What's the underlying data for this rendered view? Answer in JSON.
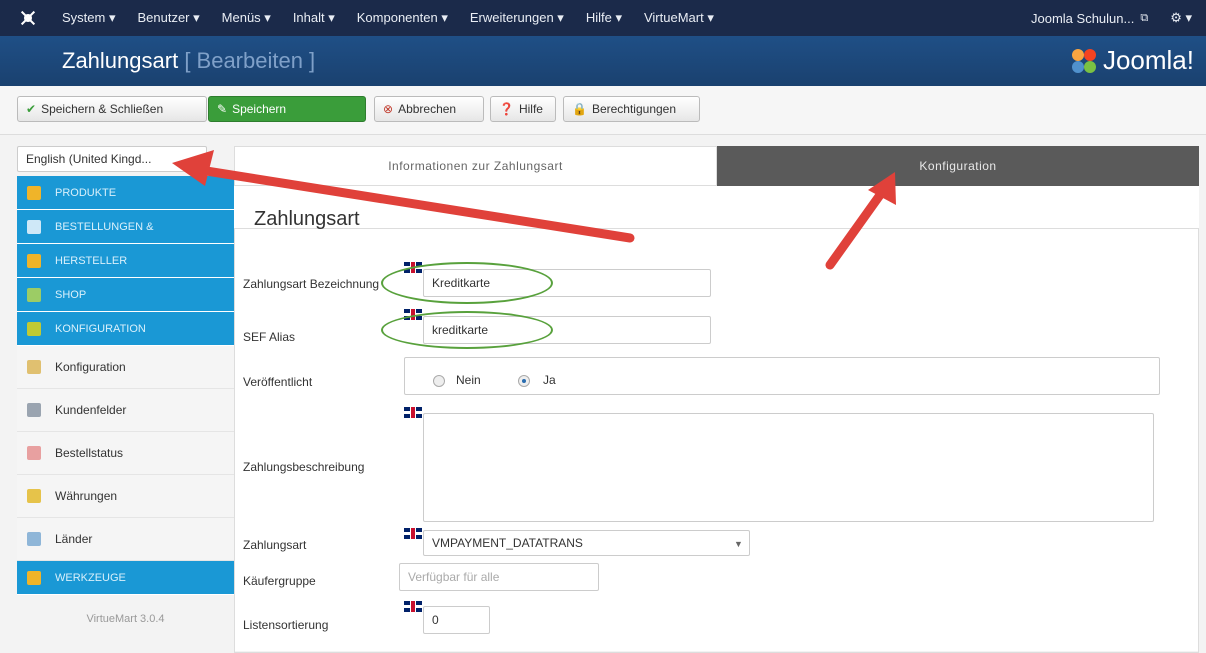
{
  "topnav": {
    "menu": [
      "System ▾",
      "Benutzer ▾",
      "Menüs ▾",
      "Inhalt ▾",
      "Komponenten ▾",
      "Erweiterungen ▾",
      "Hilfe ▾",
      "VirtueMart ▾"
    ],
    "site_link": "Joomla Schulun...",
    "external_icon": "external-link-icon",
    "settings": "⚙ ▾"
  },
  "titlebar": {
    "title": "Zahlungsart",
    "subtitle": "[ Bearbeiten ]",
    "brand": "Joomla!"
  },
  "toolbar": {
    "save_close": "Speichern & Schließen",
    "save": "Speichern",
    "cancel": "Abbrechen",
    "help": "Hilfe",
    "permissions": "Berechtigungen"
  },
  "language": {
    "selected": "English (United Kingd..."
  },
  "sidebar": {
    "items": [
      {
        "label": "PRODUKTE",
        "style": "blue",
        "icon": "box-icon",
        "color": "#f0b429"
      },
      {
        "label": "BESTELLUNGEN &",
        "style": "blue",
        "icon": "orders-icon",
        "color": "#cfe8f7"
      },
      {
        "label": "HERSTELLER",
        "style": "blue",
        "icon": "wrench-icon",
        "color": "#f0b429"
      },
      {
        "label": "SHOP",
        "style": "blue",
        "icon": "shop-icon",
        "color": "#9ccc65"
      },
      {
        "label": "KONFIGURATION",
        "style": "blue",
        "icon": "config-icon",
        "color": "#c0ca33"
      },
      {
        "label": "Konfiguration",
        "style": "white",
        "icon": "config-small-icon",
        "color": "#e0c070"
      },
      {
        "label": "Kundenfelder",
        "style": "white",
        "icon": "customer-fields-icon",
        "color": "#9aa4b0"
      },
      {
        "label": "Bestellstatus",
        "style": "white",
        "icon": "order-status-icon",
        "color": "#e8a0a0"
      },
      {
        "label": "Währungen",
        "style": "white",
        "icon": "currency-icon",
        "color": "#e6c34a"
      },
      {
        "label": "Länder",
        "style": "white",
        "icon": "globe-icon",
        "color": "#8fb6d8"
      },
      {
        "label": "WERKZEUGE",
        "style": "blue",
        "icon": "tools-icon",
        "color": "#f0b429"
      }
    ],
    "version": "VirtueMart 3.0.4"
  },
  "tabs": {
    "info": "Informationen zur Zahlungsart",
    "config": "Konfiguration"
  },
  "form": {
    "legend": "Zahlungsart",
    "name_label": "Zahlungsart Bezeichnung",
    "name_value": "Kreditkarte",
    "alias_label": "SEF Alias",
    "alias_value": "kreditkarte",
    "published_label": "Veröffentlicht",
    "no": "Nein",
    "yes": "Ja",
    "description_label": "Zahlungsbeschreibung",
    "method_label": "Zahlungsart",
    "method_value": "VMPAYMENT_DATATRANS",
    "group_label": "Käufergruppe",
    "group_placeholder": "Verfügbar für alle",
    "order_label": "Listensortierung",
    "order_value": "0"
  },
  "colors": {
    "accent_blue": "#1a98d5",
    "save_green": "#3a9d3a",
    "arrow_red": "#e0413a",
    "ellipse_green": "#58a13c"
  }
}
